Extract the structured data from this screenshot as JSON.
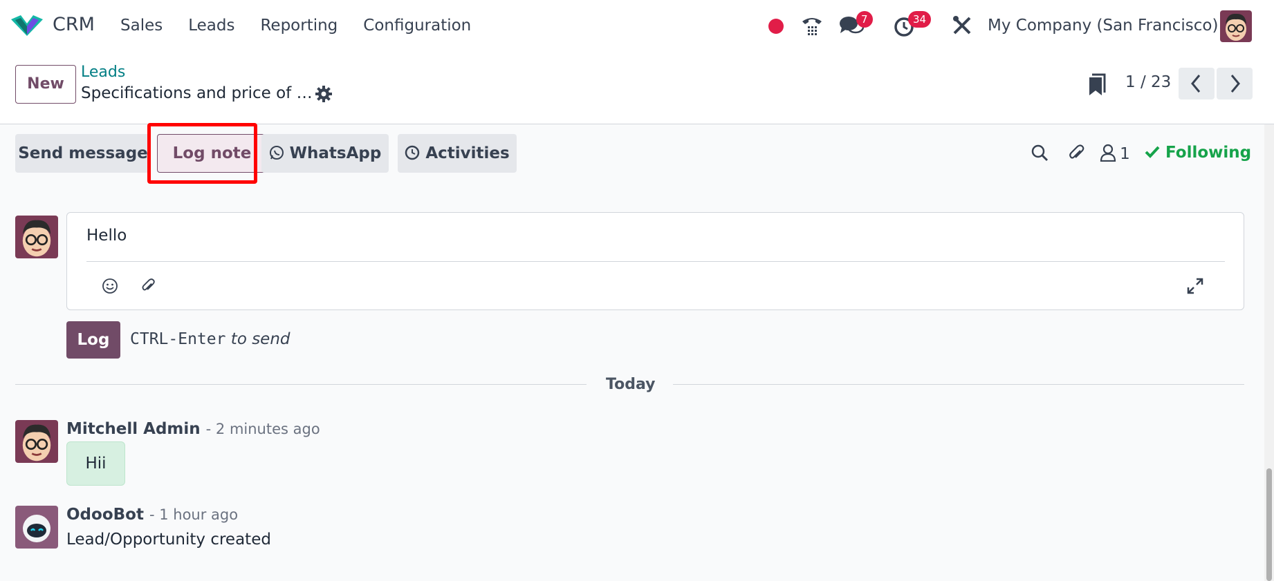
{
  "app": {
    "name": "CRM"
  },
  "menu": [
    "Sales",
    "Leads",
    "Reporting",
    "Configuration"
  ],
  "systray": {
    "messages_count": "7",
    "activities_count": "34",
    "company": "My Company (San Francisco)"
  },
  "breadcrumb": {
    "new_label": "New",
    "parent": "Leads",
    "current": "Specifications and price of …"
  },
  "pager": {
    "value": "1 / 23"
  },
  "chatter": {
    "send_message": "Send message",
    "log_note": "Log note",
    "whatsapp": "WhatsApp",
    "activities": "Activities",
    "followers_count": "1",
    "following": "Following"
  },
  "composer": {
    "text": "Hello",
    "log_button": "Log",
    "shortcut": "CTRL-Enter",
    "shortcut_suffix": "to send"
  },
  "separator": "Today",
  "messages": [
    {
      "author": "Mitchell Admin",
      "date": "- 2 minutes ago",
      "body": "Hii"
    },
    {
      "author": "OdooBot",
      "date": "- 1 hour ago",
      "body": "Lead/Opportunity created"
    }
  ],
  "colors": {
    "brand": "#714b67",
    "link": "#017e84",
    "badge": "#e11d48",
    "following": "#16a34a",
    "highlight": "#ff0000"
  },
  "icons": [
    "crm-logo-icon",
    "record-dot-icon",
    "phone-icon",
    "chat-icon",
    "clock-icon",
    "tools-icon",
    "gear-icon",
    "bookmark-icon",
    "chevron-left-icon",
    "chevron-right-icon",
    "whatsapp-icon",
    "clock-icon",
    "search-icon",
    "paperclip-icon",
    "user-icon",
    "check-icon",
    "emoji-icon",
    "expand-icon"
  ]
}
